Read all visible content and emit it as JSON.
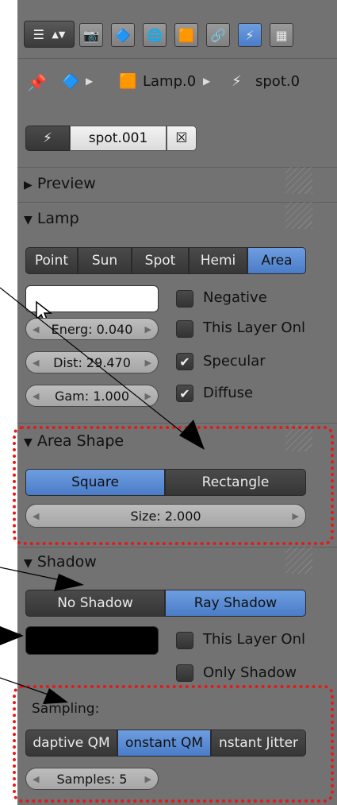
{
  "header": {
    "tabs": [
      "render-icon",
      "scene-icon",
      "world-icon",
      "object-icon",
      "constraints-icon",
      "lamp-data-icon",
      "texture-icon"
    ],
    "active_tab": "lamp-data-icon"
  },
  "breadcrumb": {
    "object": "Lamp.0",
    "data": "spot.0"
  },
  "datablock": {
    "name": "spot.001"
  },
  "panels": {
    "preview": "Preview",
    "lamp": "Lamp",
    "area_shape": "Area Shape",
    "shadow": "Shadow"
  },
  "lamp": {
    "types": [
      "Point",
      "Sun",
      "Spot",
      "Hemi",
      "Area"
    ],
    "active_type": "Area",
    "color": "#ffffff",
    "energy": "Energ: 0.040",
    "distance": "Dist: 29.470",
    "gamma": "Gam: 1.000",
    "negative_label": "Negative",
    "negative": false,
    "this_layer_label": "This Layer Onl",
    "this_layer": false,
    "specular_label": "Specular",
    "specular": true,
    "diffuse_label": "Diffuse",
    "diffuse": true
  },
  "area_shape": {
    "options": [
      "Square",
      "Rectangle"
    ],
    "active": "Square",
    "size": "Size: 2.000"
  },
  "shadow": {
    "options": [
      "No Shadow",
      "Ray Shadow"
    ],
    "active": "Ray Shadow",
    "color": "#000000",
    "this_layer_label": "This Layer Onl",
    "this_layer": false,
    "only_shadow_label": "Only Shadow",
    "only_shadow": false,
    "sampling_label": "Sampling:",
    "sampling_methods": [
      "daptive QM",
      "onstant QM",
      "nstant Jitter"
    ],
    "active_sampling": "onstant QM",
    "samples": "Samples: 5"
  },
  "colors": {
    "panel_bg": "#727272",
    "active_blue": "#5a8ad6",
    "highlight_red": "#e81818"
  }
}
